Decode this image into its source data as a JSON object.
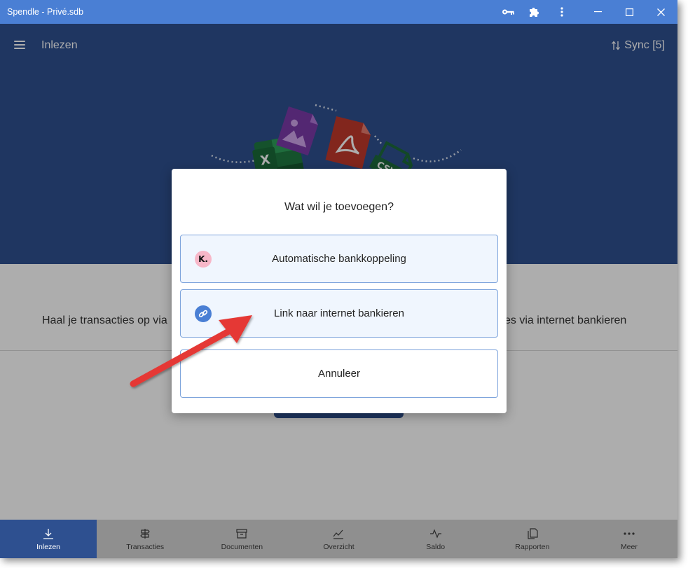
{
  "window": {
    "title": "Spendle - Privé.sdb"
  },
  "appbar": {
    "title": "Inlezen",
    "sync_label": "Sync [5]"
  },
  "hero": {
    "icons": [
      "excel-icon",
      "image-file-icon",
      "pdf-icon",
      "csv-icon",
      "hand-pointer-icon"
    ],
    "csv_text": "CSV",
    "excel_text": "X"
  },
  "content": {
    "desc_left": "Haal je transacties op via",
    "desc_right": "es via internet bankieren"
  },
  "dialog": {
    "title": "Wat wil je toevoegen?",
    "options": [
      {
        "label": "Automatische bankkoppeling",
        "icon": "klarna-k-icon",
        "icon_text": "K."
      },
      {
        "label": "Link naar internet bankieren",
        "icon": "link-icon"
      }
    ],
    "cancel_label": "Annuleer"
  },
  "nav": {
    "items": [
      {
        "label": "Inlezen",
        "icon": "download-icon",
        "active": true
      },
      {
        "label": "Transacties",
        "icon": "signpost-icon"
      },
      {
        "label": "Documenten",
        "icon": "archive-icon"
      },
      {
        "label": "Overzicht",
        "icon": "chart-line-icon"
      },
      {
        "label": "Saldo",
        "icon": "pulse-icon"
      },
      {
        "label": "Rapporten",
        "icon": "reports-icon"
      },
      {
        "label": "Meer",
        "icon": "more-dots-icon"
      }
    ]
  },
  "colors": {
    "titlebar": "#4a7fd4",
    "primary": "#2e5090",
    "option_border": "#7ea4dc",
    "arrow": "#e53935"
  }
}
